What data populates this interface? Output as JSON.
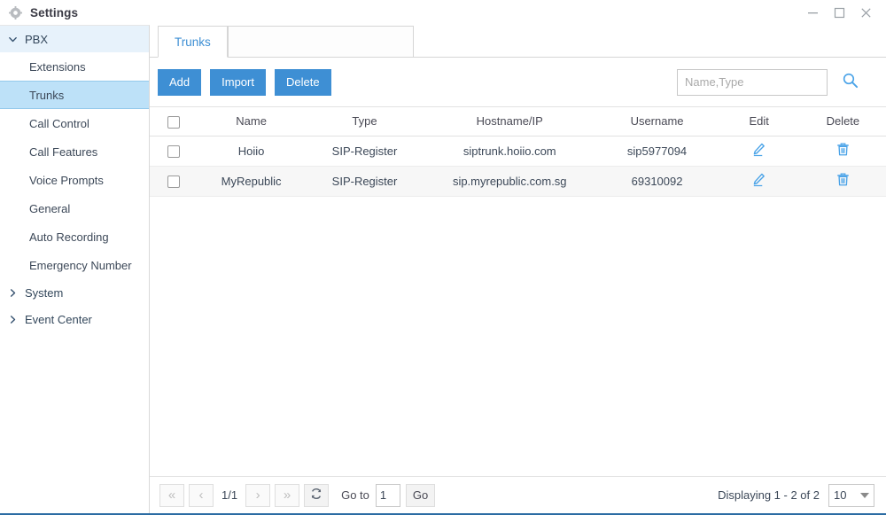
{
  "window": {
    "title": "Settings",
    "gear_icon": "gear-icon",
    "controls": {
      "minimize": "minimize-icon",
      "maximize": "maximize-icon",
      "close": "close-icon"
    },
    "accent_color": "#3e8fd4",
    "bottom_rule_color": "#2b6ca3"
  },
  "sidebar": {
    "groups": [
      {
        "label": "PBX",
        "expanded": true,
        "icon": "chevron-down-icon",
        "items": [
          {
            "label": "Extensions",
            "active": false
          },
          {
            "label": "Trunks",
            "active": true
          },
          {
            "label": "Call Control",
            "active": false
          },
          {
            "label": "Call Features",
            "active": false
          },
          {
            "label": "Voice Prompts",
            "active": false
          },
          {
            "label": "General",
            "active": false
          },
          {
            "label": "Auto Recording",
            "active": false
          },
          {
            "label": "Emergency Number",
            "active": false
          }
        ]
      },
      {
        "label": "System",
        "expanded": false,
        "icon": "chevron-right-icon",
        "items": []
      },
      {
        "label": "Event Center",
        "expanded": false,
        "icon": "chevron-right-icon",
        "items": []
      }
    ]
  },
  "tabs": [
    {
      "label": "Trunks",
      "active": true
    }
  ],
  "toolbar": {
    "add_label": "Add",
    "import_label": "Import",
    "delete_label": "Delete",
    "search_placeholder": "Name,Type",
    "search_value": "",
    "search_icon": "search-icon"
  },
  "table": {
    "columns": [
      {
        "key": "checkbox",
        "label": ""
      },
      {
        "key": "name",
        "label": "Name"
      },
      {
        "key": "type",
        "label": "Type"
      },
      {
        "key": "hostname",
        "label": "Hostname/IP"
      },
      {
        "key": "username",
        "label": "Username"
      },
      {
        "key": "edit",
        "label": "Edit"
      },
      {
        "key": "delete",
        "label": "Delete"
      }
    ],
    "rows": [
      {
        "checked": false,
        "name": "Hoiio",
        "type": "SIP-Register",
        "hostname": "siptrunk.hoiio.com",
        "username": "sip5977094",
        "edit_icon": "edit-pencil-icon",
        "delete_icon": "trash-icon"
      },
      {
        "checked": false,
        "name": "MyRepublic",
        "type": "SIP-Register",
        "hostname": "sip.myrepublic.com.sg",
        "username": "69310092",
        "edit_icon": "edit-pencil-icon",
        "delete_icon": "trash-icon"
      }
    ]
  },
  "footer": {
    "first_label": "«",
    "prev_label": "‹",
    "page_indicator": "1/1",
    "next_label": "›",
    "last_label": "»",
    "refresh_icon": "refresh-icon",
    "goto_label": "Go to",
    "goto_value": "1",
    "go_label": "Go",
    "displaying": "Displaying 1 - 2 of 2",
    "page_size": "10",
    "page_size_caret": "caret-down-icon"
  }
}
